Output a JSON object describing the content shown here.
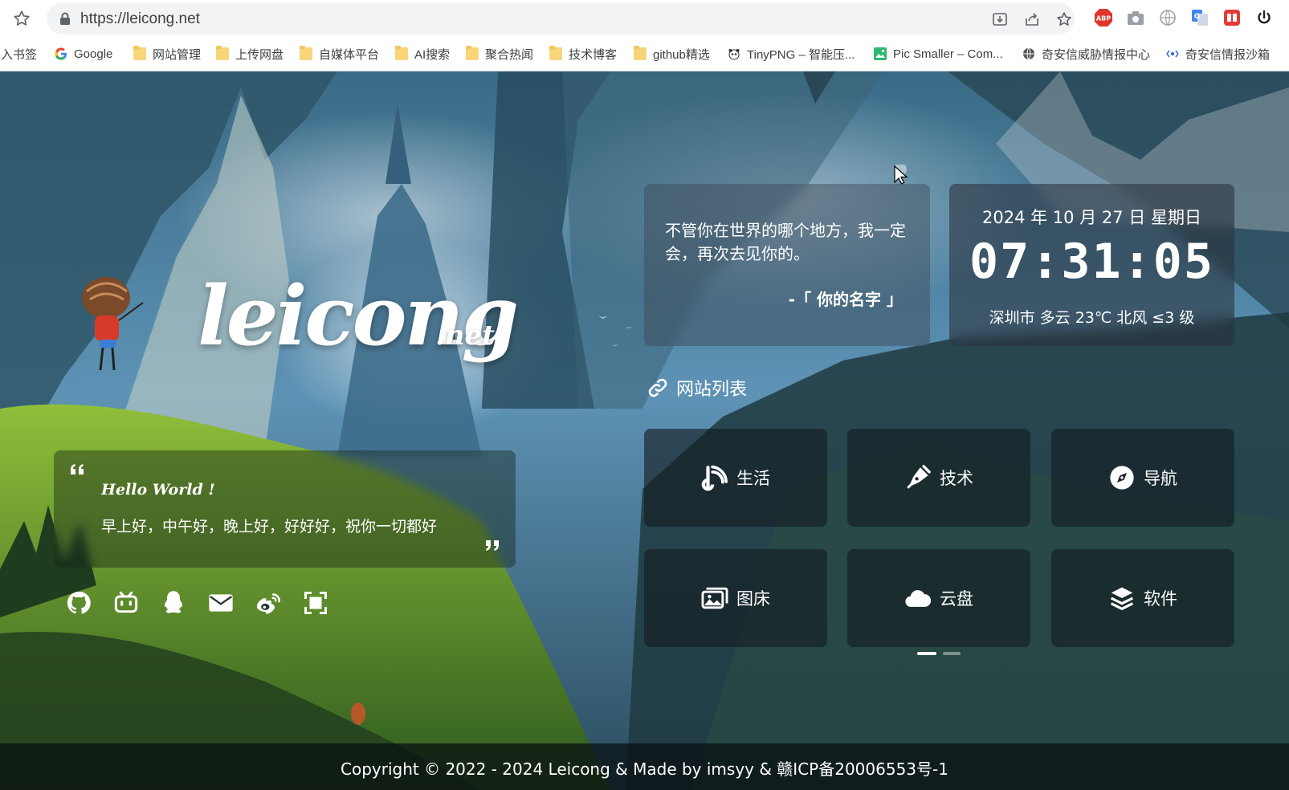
{
  "browser": {
    "url": "https://leicong.net",
    "bookmarks": [
      {
        "label": "导入书签",
        "icon": "folder-icon"
      },
      {
        "label": "Google",
        "icon": "google-icon"
      },
      {
        "label": "网站管理",
        "icon": "folder-icon"
      },
      {
        "label": "上传网盘",
        "icon": "folder-icon"
      },
      {
        "label": "自媒体平台",
        "icon": "folder-icon"
      },
      {
        "label": "AI搜索",
        "icon": "folder-icon"
      },
      {
        "label": "聚合热闻",
        "icon": "folder-icon"
      },
      {
        "label": "技术博客",
        "icon": "folder-icon"
      },
      {
        "label": "github精选",
        "icon": "folder-icon"
      },
      {
        "label": "TinyPNG – 智能压...",
        "icon": "panda-icon"
      },
      {
        "label": "Pic Smaller – Com...",
        "icon": "image-icon"
      },
      {
        "label": "奇安信威胁情报中心",
        "icon": "globe-icon"
      },
      {
        "label": "奇安信情报沙箱",
        "icon": "sandbox-icon"
      }
    ]
  },
  "site": {
    "logo": {
      "main": "leicong",
      "suffix": ".net"
    },
    "quote": {
      "title": "Hello World !",
      "text": "早上好，中午好，晚上好，好好好，祝你一切都好"
    },
    "socials": [
      "github-icon",
      "bilibili-icon",
      "qq-icon",
      "mail-icon",
      "weibo-icon",
      "scan-icon"
    ],
    "motto": {
      "text": "不管你在世界的哪个地方，我一定会，再次去见你的。",
      "author": "-「 你的名字 」"
    },
    "clock": {
      "date": "2024 年 10 月 27 日 星期日",
      "time": "07:31:05",
      "weather": "深圳市 多云 23℃ 北风 ≤3 级"
    },
    "sites_heading": "网站列表",
    "tiles": [
      {
        "label": "生活",
        "icon": "feed-icon"
      },
      {
        "label": "技术",
        "icon": "pen-icon"
      },
      {
        "label": "导航",
        "icon": "compass-icon"
      },
      {
        "label": "图床",
        "icon": "images-icon"
      },
      {
        "label": "云盘",
        "icon": "cloud-icon"
      },
      {
        "label": "软件",
        "icon": "layers-icon"
      }
    ],
    "pager": {
      "current": 1,
      "total": 2
    },
    "footer": "Copyright © 2022 - 2024 Leicong & Made by imsyy & 赣ICP备20006553号-1"
  }
}
